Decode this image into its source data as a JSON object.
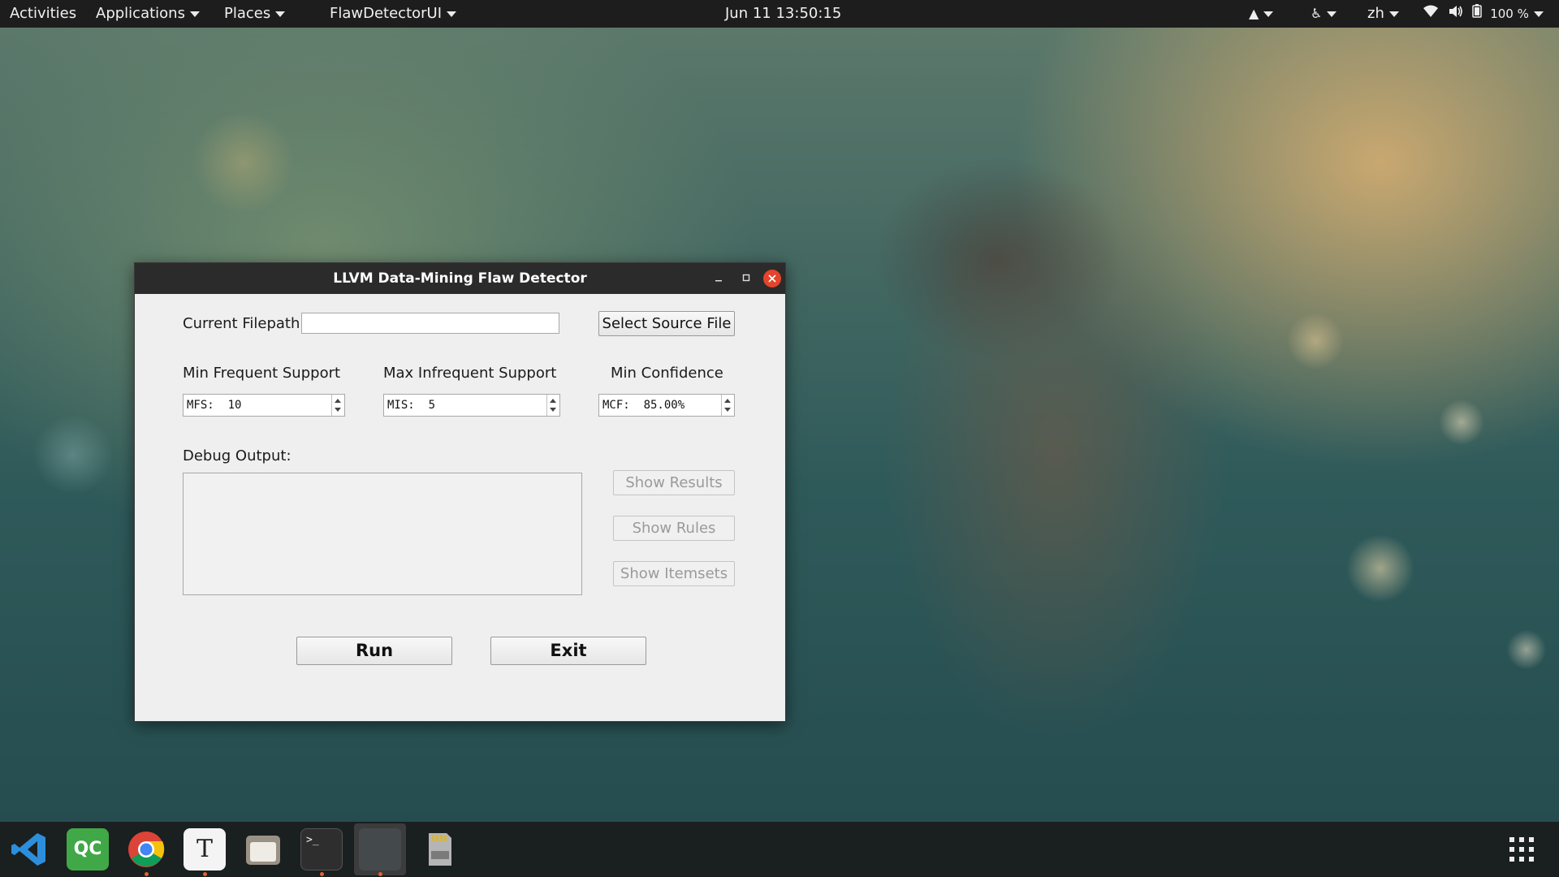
{
  "topbar": {
    "activities": "Activities",
    "applications": "Applications",
    "places": "Places",
    "app_menu": "FlawDetectorUI",
    "clock": "Jun 11  13:50:15",
    "language": "zh",
    "battery": "100 %"
  },
  "window": {
    "title": "LLVM Data-Mining Flaw Detector",
    "filepath_label": "Current Filepath:",
    "filepath_value": "",
    "select_source_label": "Select Source File",
    "min_freq_label": "Min Frequent Support",
    "max_infreq_label": "Max Infrequent Support",
    "min_conf_label": "Min Confidence",
    "mfs_value": "MFS:  10",
    "mis_value": "MIS:  5",
    "mcf_value": "MCF:  85.00%",
    "debug_label": "Debug Output:",
    "show_results_label": "Show Results",
    "show_rules_label": "Show Rules",
    "show_itemsets_label": "Show Itemsets",
    "run_label": "Run",
    "exit_label": "Exit"
  },
  "dock": {
    "qc_label": "QC",
    "text_editor_label": "T",
    "terminal_label": ">_"
  },
  "icons": [
    "vscode-icon",
    "qtcreator-icon",
    "chrome-icon",
    "text-editor-icon",
    "files-icon",
    "terminal-icon",
    "active-window-icon",
    "sd-card-icon",
    "app-grid-icon",
    "accessibility-icon",
    "wifi-icon",
    "volume-icon",
    "battery-icon",
    "notification-icon"
  ]
}
